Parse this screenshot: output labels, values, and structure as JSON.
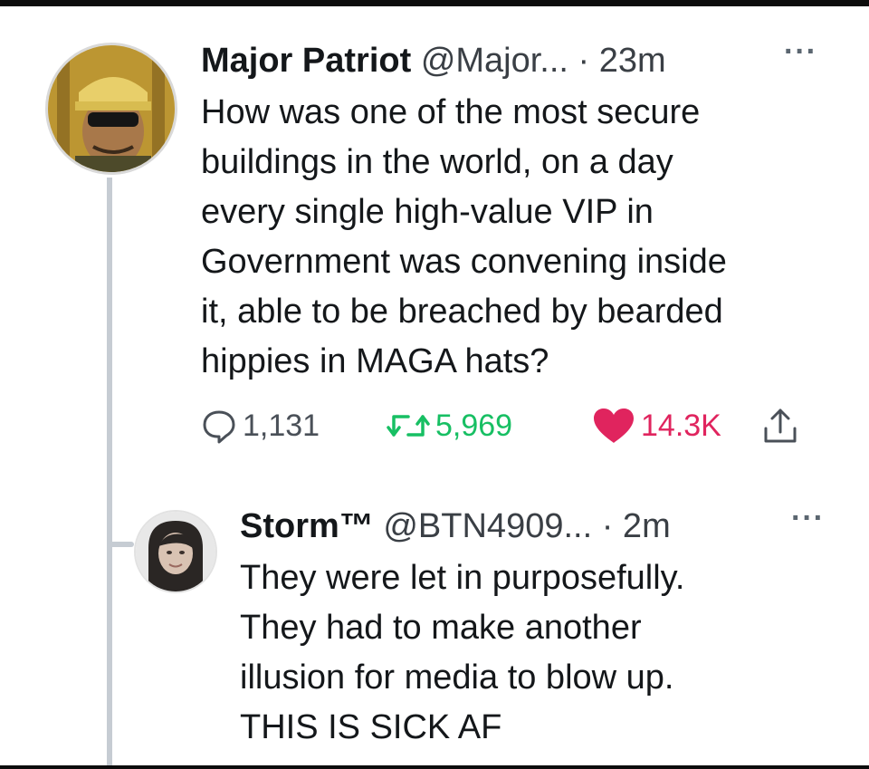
{
  "tweet": {
    "author_name": "Major Patriot",
    "author_handle": "@Major...",
    "time": "· 23m",
    "more_icon": "···",
    "text_lines": [
      "How was one of the most secure",
      "buildings in the world, on a day",
      "every single high-value VIP in",
      "Government was convening inside",
      "it, able to be breached by bearded",
      "hippies in MAGA hats?"
    ],
    "actions": {
      "reply_count": "1,131",
      "retweet_count": "5,969",
      "like_count": "14.3K"
    },
    "icons": [
      "reply-icon",
      "retweet-icon",
      "like-icon",
      "share-icon"
    ],
    "colors": {
      "retweet": "#17bf63",
      "like": "#e0245e",
      "thread_line": "#c6ccd3"
    }
  },
  "reply": {
    "author_name": "Storm™",
    "author_handle": "@BTN4909...",
    "time": "· 2m",
    "more_icon": "···",
    "text_lines": [
      "They were let in purposefully.",
      "They had to make another",
      "illusion for media to blow up.",
      "THIS IS SICK AF"
    ]
  }
}
